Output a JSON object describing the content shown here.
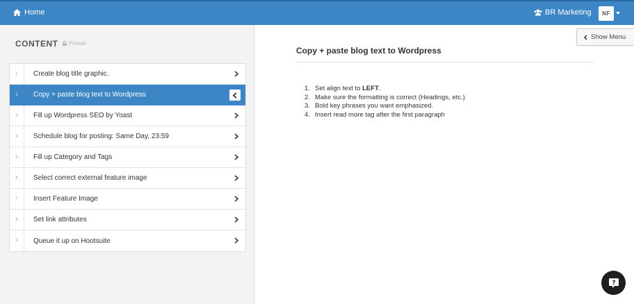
{
  "nav": {
    "home_label": "Home",
    "team_label": "BR Marketing",
    "avatar_initials": "NF"
  },
  "sidebar": {
    "title": "CONTENT",
    "privacy": "Private",
    "steps": [
      {
        "num": "1",
        "label": "Create blog title graphic."
      },
      {
        "num": "2",
        "label": "Copy + paste blog text to Wordpress",
        "active": true
      },
      {
        "num": "3",
        "label": "Fill up Wordpress SEO by Yoast"
      },
      {
        "num": "4",
        "label": "Schedule blog for posting: Same Day, 23:59"
      },
      {
        "num": "5",
        "label": "Fill up Category and Tags"
      },
      {
        "num": "6",
        "label": "Select correct external feature image"
      },
      {
        "num": "7",
        "label": "Insert Feature Image"
      },
      {
        "num": "8",
        "label": "Set link attributes"
      },
      {
        "num": "9",
        "label": "Queue it up on Hootsuite"
      }
    ]
  },
  "main": {
    "show_menu_label": "Show Menu",
    "task_title": "Copy + paste blog text to Wordpress",
    "instructions": [
      {
        "num": "1.",
        "prefix": "Set align text to ",
        "bold": "LEFT",
        "suffix": "."
      },
      {
        "num": "2.",
        "text": "Make sure the formatting is correct (Headings, etc.)"
      },
      {
        "num": "3.",
        "text": "Bold key phrases you want emphasized."
      },
      {
        "num": "4.",
        "text": "Insert read more tag after the first paragraph"
      }
    ]
  },
  "help_icon": "question-bubble-icon",
  "colors": {
    "accent": "#3d86c6",
    "help_button": "#1f1f1f"
  }
}
